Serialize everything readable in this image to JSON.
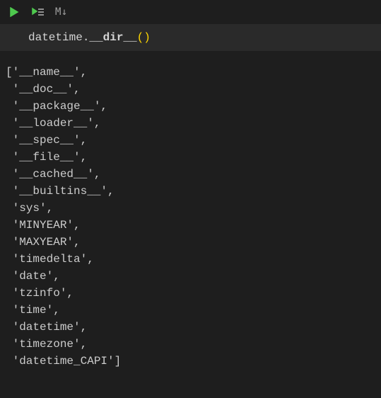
{
  "toolbar": {
    "markdown_label": "M↓"
  },
  "cell": {
    "code": {
      "obj": "datetime",
      "dot": ".",
      "method": "__dir__",
      "paren_open": "(",
      "paren_close": ")"
    }
  },
  "output": {
    "lines": [
      "['__name__',",
      " '__doc__',",
      " '__package__',",
      " '__loader__',",
      " '__spec__',",
      " '__file__',",
      " '__cached__',",
      " '__builtins__',",
      " 'sys',",
      " 'MINYEAR',",
      " 'MAXYEAR',",
      " 'timedelta',",
      " 'date',",
      " 'tzinfo',",
      " 'time',",
      " 'datetime',",
      " 'timezone',",
      " 'datetime_CAPI']"
    ]
  }
}
